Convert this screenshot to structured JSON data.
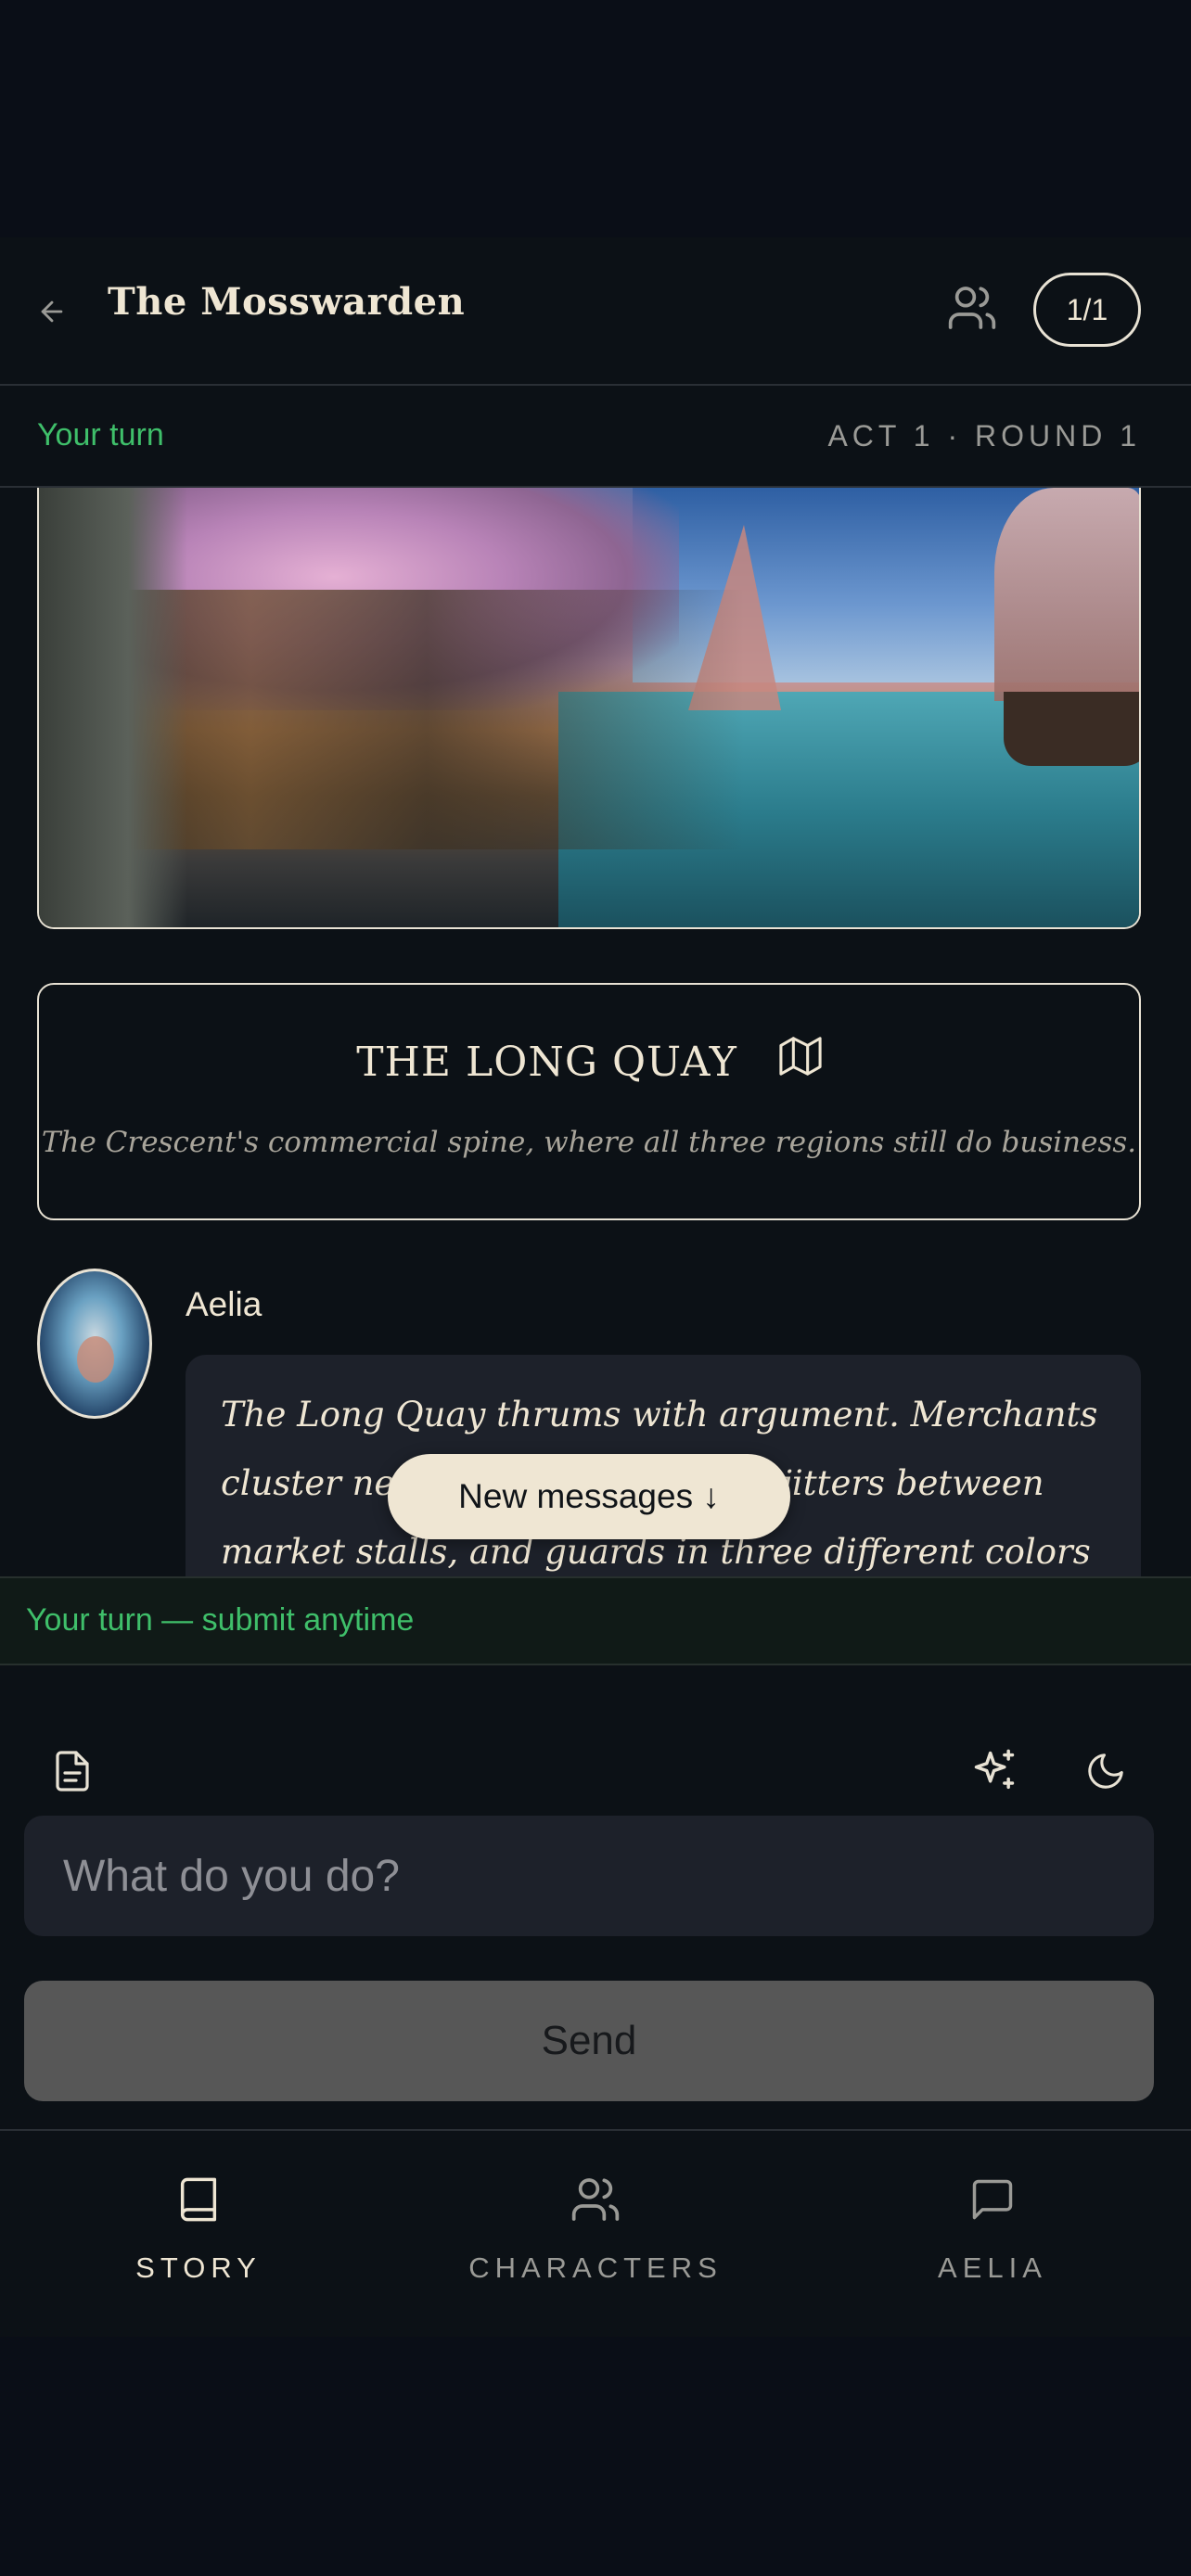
{
  "header": {
    "title": "The Mosswarden",
    "back_icon": "arrow-left-icon",
    "players_icon": "users-icon",
    "count": "1/1"
  },
  "turn": {
    "status": "Your turn",
    "round": "ACT 1 · ROUND 1"
  },
  "location": {
    "title": "THE LONG QUAY",
    "icon": "map-icon",
    "description": "The Crescent's commercial spine, where all three regions still do business."
  },
  "message": {
    "speaker": "Aelia",
    "text": "The Long Quay thrums with argument. Merchants cluster near the docks, a crowd jitters between market stalls, and guards in three different colors of armor watch",
    "new_messages": "New messages ↓"
  },
  "composer": {
    "status": "Your turn — submit anytime",
    "placeholder": "What do you do?",
    "send_label": "Send",
    "tools": [
      "document-icon",
      "sparkles-icon",
      "moon-icon"
    ]
  },
  "nav": {
    "items": [
      {
        "label": "STORY",
        "icon": "book-icon",
        "active": true
      },
      {
        "label": "CHARACTERS",
        "icon": "users-icon",
        "active": false
      },
      {
        "label": "AELIA",
        "icon": "message-square-icon",
        "active": false
      }
    ]
  },
  "colors": {
    "accent_green": "#3fbf6a",
    "cream": "#efe6d3",
    "background": "#0c1116"
  }
}
